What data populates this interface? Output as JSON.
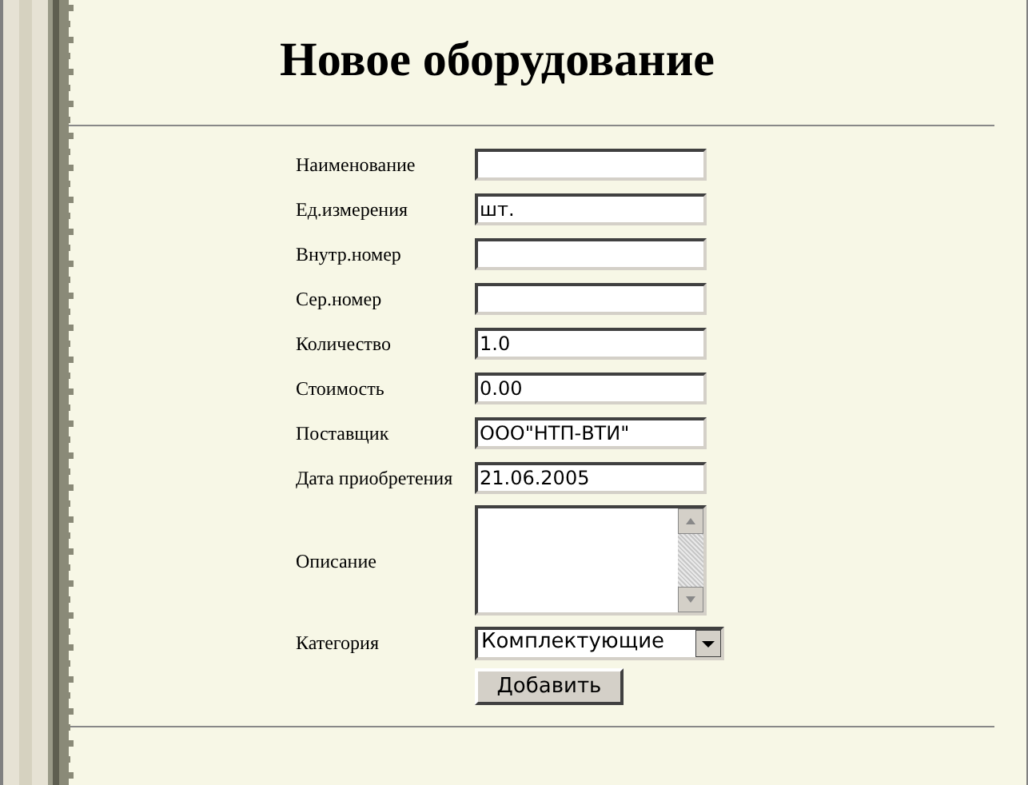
{
  "title": "Новое оборудование",
  "fields": [
    {
      "kind": "text",
      "label": "Наименование"
    },
    {
      "kind": "text",
      "label": "Ед.измерения",
      "value": "шт."
    },
    {
      "kind": "text",
      "label": "Внутр.номер"
    },
    {
      "kind": "text",
      "label": "Сер.номер"
    },
    {
      "kind": "text",
      "label": "Количество",
      "value": "1.0"
    },
    {
      "kind": "text",
      "label": "Стоимость",
      "value": "0.00"
    },
    {
      "kind": "text",
      "label": "Поставщик",
      "value": "ООО\"НТП-ВТИ\""
    },
    {
      "kind": "text",
      "label": "Дата приобретения",
      "value": "21.06.2005"
    },
    {
      "kind": "textarea",
      "label": "Описание"
    },
    {
      "kind": "select",
      "label": "Категория",
      "value": "Комплектующие"
    }
  ],
  "submit": "Добавить"
}
